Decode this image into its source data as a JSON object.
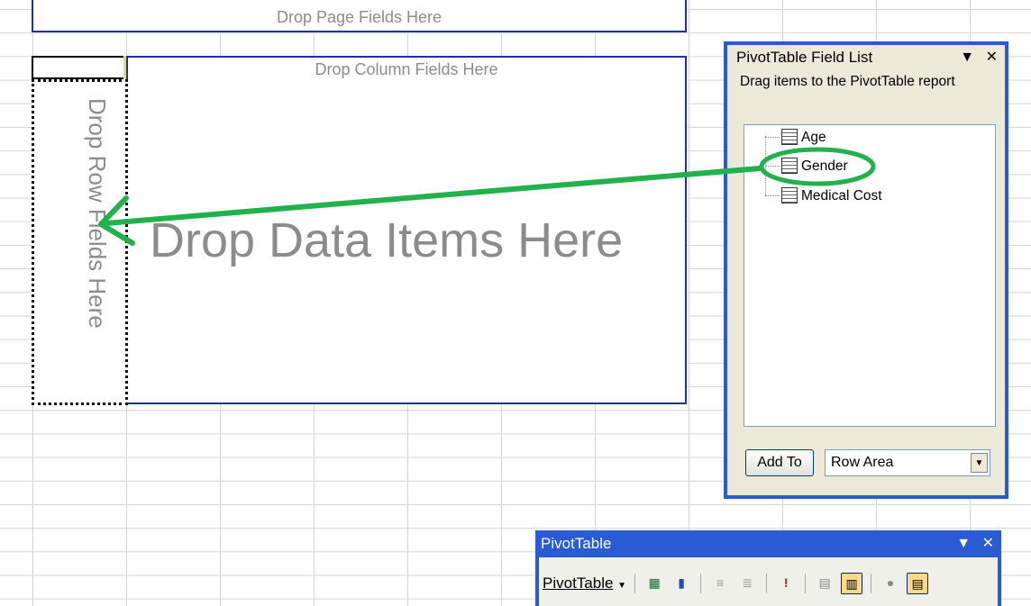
{
  "zones": {
    "page": "Drop Page Fields Here",
    "column": "Drop Column Fields Here",
    "row": "Drop Row Fields Here",
    "data": "Drop Data Items Here"
  },
  "field_list": {
    "title": "PivotTable Field List",
    "instruction": "Drag items to the PivotTable report",
    "items": [
      {
        "label": "Age"
      },
      {
        "label": "Gender"
      },
      {
        "label": "Medical Cost"
      }
    ],
    "add_to_label": "Add To",
    "area_value": "Row Area"
  },
  "toolbar": {
    "title": "PivotTable",
    "menu_label": "PivotTable"
  },
  "colors": {
    "zone_border": "#1c2fb0",
    "annotation": "#22b14c",
    "panel_border": "#2a5bd3"
  }
}
